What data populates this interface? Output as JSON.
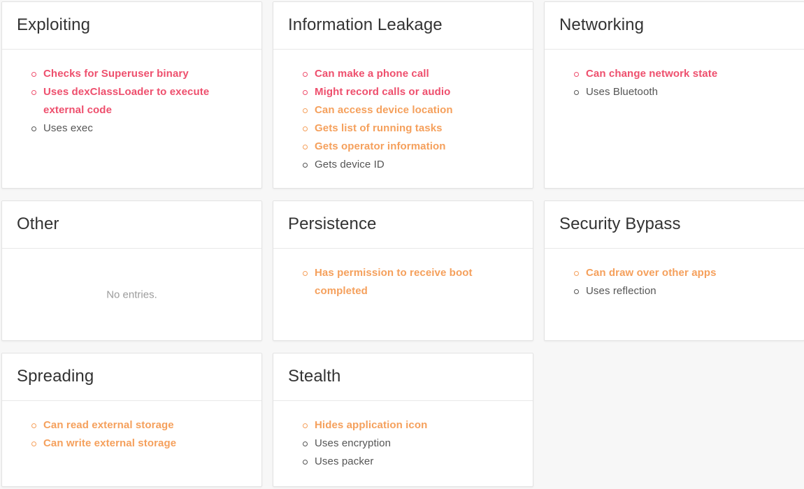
{
  "page": {
    "background_color": "#f7f7f7",
    "empty_message": "No entries."
  },
  "severity_colors": {
    "high": "#ee4f6d",
    "medium": "#f5a05c",
    "low": "#555555"
  },
  "cards": [
    {
      "title": "Exploiting",
      "items": [
        {
          "label": "Checks for Superuser binary",
          "severity": "high"
        },
        {
          "label": "Uses dexClassLoader to execute external code",
          "severity": "high"
        },
        {
          "label": "Uses exec",
          "severity": "low"
        }
      ]
    },
    {
      "title": "Information Leakage",
      "items": [
        {
          "label": "Can make a phone call",
          "severity": "high"
        },
        {
          "label": "Might record calls or audio",
          "severity": "high"
        },
        {
          "label": "Can access device location",
          "severity": "medium"
        },
        {
          "label": "Gets list of running tasks",
          "severity": "medium"
        },
        {
          "label": "Gets operator information",
          "severity": "medium"
        },
        {
          "label": "Gets device ID",
          "severity": "low"
        }
      ]
    },
    {
      "title": "Networking",
      "items": [
        {
          "label": "Can change network state",
          "severity": "high"
        },
        {
          "label": "Uses Bluetooth",
          "severity": "low"
        }
      ]
    },
    {
      "title": "Other",
      "items": []
    },
    {
      "title": "Persistence",
      "items": [
        {
          "label": "Has permission to receive boot completed",
          "severity": "medium"
        }
      ]
    },
    {
      "title": "Security Bypass",
      "items": [
        {
          "label": "Can draw over other apps",
          "severity": "medium"
        },
        {
          "label": "Uses reflection",
          "severity": "low"
        }
      ]
    },
    {
      "title": "Spreading",
      "items": [
        {
          "label": "Can read external storage",
          "severity": "medium"
        },
        {
          "label": "Can write external storage",
          "severity": "medium"
        }
      ]
    },
    {
      "title": "Stealth",
      "items": [
        {
          "label": "Hides application icon",
          "severity": "medium"
        },
        {
          "label": "Uses encryption",
          "severity": "low"
        },
        {
          "label": "Uses packer",
          "severity": "low"
        }
      ]
    }
  ]
}
